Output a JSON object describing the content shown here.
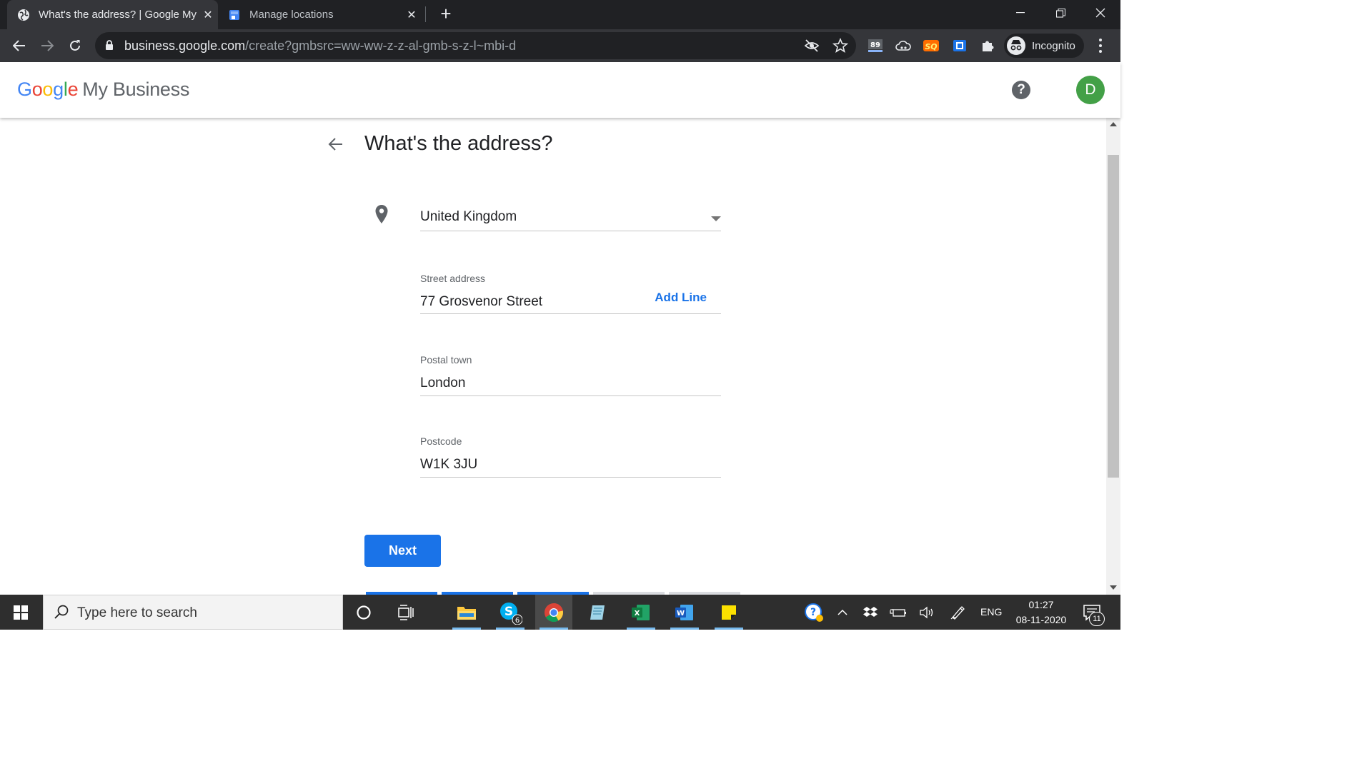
{
  "browser": {
    "tabs": [
      {
        "title": "What's the address? | Google My Business",
        "active": true
      },
      {
        "title": "Manage locations",
        "active": false
      }
    ],
    "url_host": "business.google.com",
    "url_path": "/create?gmbsrc=ww-ww-z-z-al-gmb-s-z-l~mbi-d",
    "extensions": {
      "badge_count": "89"
    },
    "profile_label": "Incognito"
  },
  "header": {
    "logo_google": [
      "G",
      "o",
      "o",
      "g",
      "l",
      "e"
    ],
    "product_name": "My Business",
    "help_label": "?",
    "avatar_initial": "D"
  },
  "form": {
    "title": "What's the address?",
    "country": "United Kingdom",
    "street_label": "Street address",
    "street_value": "77 Grosvenor Street",
    "add_line_label": "Add Line",
    "town_label": "Postal town",
    "town_value": "London",
    "postcode_label": "Postcode",
    "postcode_value": "W1K 3JU",
    "next_label": "Next"
  },
  "taskbar": {
    "search_placeholder": "Type here to search",
    "skype_badge": "6",
    "language": "ENG",
    "time": "01:27",
    "date": "08-11-2020",
    "notification_count": "11"
  },
  "colors": {
    "accent": "#1a73e8",
    "avatar": "#43a047",
    "chrome_dark": "#202124",
    "taskbar": "#2e2e2e"
  }
}
